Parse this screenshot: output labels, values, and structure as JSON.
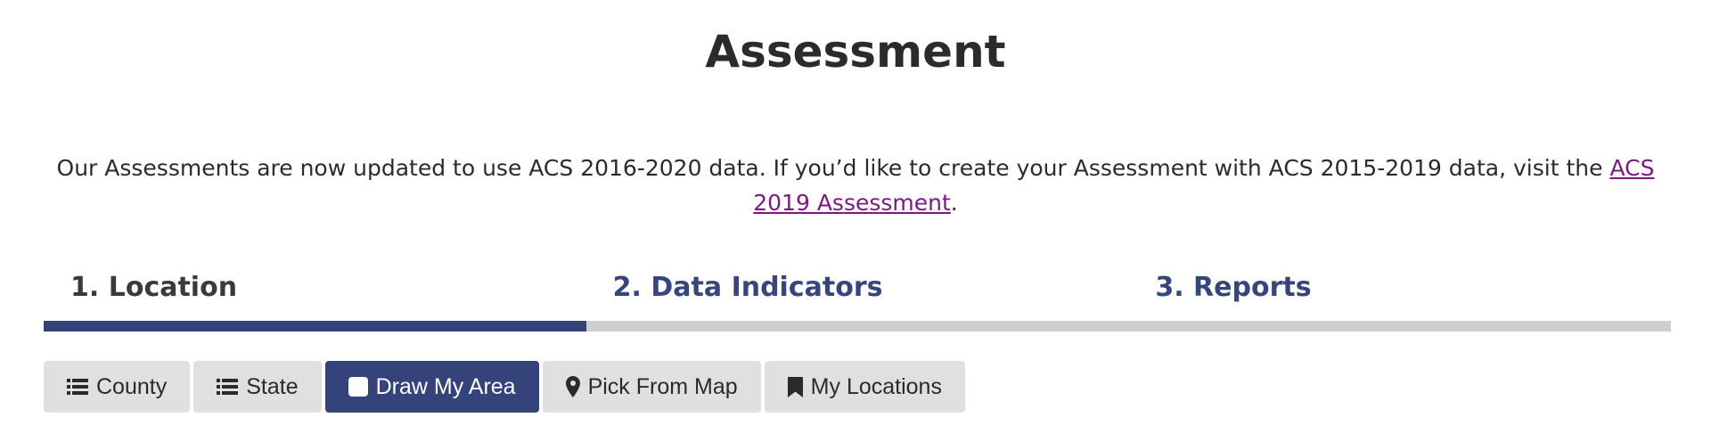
{
  "page": {
    "title": "Assessment"
  },
  "notice": {
    "text": "Our Assessments are now updated to use ACS 2016-2020 data. If you’d like to create your Assessment with ACS 2015-2019 data, visit the ",
    "link_label": "ACS 2019 Assessment",
    "trailing": "."
  },
  "tabs": [
    {
      "label": "1. Location",
      "active": true
    },
    {
      "label": "2. Data Indicators",
      "active": false
    },
    {
      "label": "3. Reports",
      "active": false
    }
  ],
  "location_buttons": [
    {
      "label": "County",
      "icon": "list-icon",
      "selected": false
    },
    {
      "label": "State",
      "icon": "list-icon",
      "selected": false
    },
    {
      "label": "Draw My Area",
      "icon": "square-icon",
      "selected": true
    },
    {
      "label": "Pick From Map",
      "icon": "map-marker-icon",
      "selected": false
    },
    {
      "label": "My Locations",
      "icon": "bookmark-icon",
      "selected": false
    }
  ],
  "colors": {
    "accent": "#34447a",
    "tab_track": "#cfcfcf",
    "button_bg": "#e0e0e0",
    "link": "#7a1a7e"
  }
}
